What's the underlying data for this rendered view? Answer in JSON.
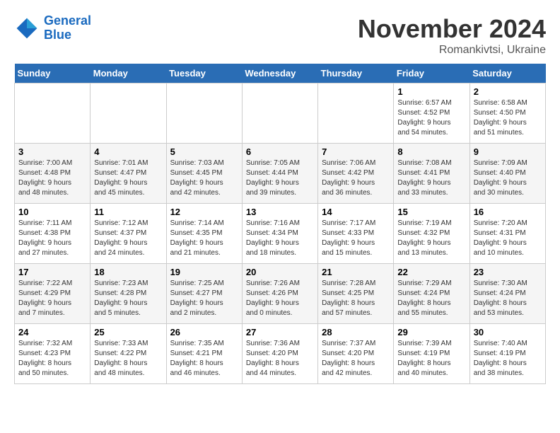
{
  "header": {
    "logo_line1": "General",
    "logo_line2": "Blue",
    "month_year": "November 2024",
    "location": "Romankivtsi, Ukraine"
  },
  "weekdays": [
    "Sunday",
    "Monday",
    "Tuesday",
    "Wednesday",
    "Thursday",
    "Friday",
    "Saturday"
  ],
  "weeks": [
    [
      {
        "day": "",
        "info": ""
      },
      {
        "day": "",
        "info": ""
      },
      {
        "day": "",
        "info": ""
      },
      {
        "day": "",
        "info": ""
      },
      {
        "day": "",
        "info": ""
      },
      {
        "day": "1",
        "info": "Sunrise: 6:57 AM\nSunset: 4:52 PM\nDaylight: 9 hours\nand 54 minutes."
      },
      {
        "day": "2",
        "info": "Sunrise: 6:58 AM\nSunset: 4:50 PM\nDaylight: 9 hours\nand 51 minutes."
      }
    ],
    [
      {
        "day": "3",
        "info": "Sunrise: 7:00 AM\nSunset: 4:48 PM\nDaylight: 9 hours\nand 48 minutes."
      },
      {
        "day": "4",
        "info": "Sunrise: 7:01 AM\nSunset: 4:47 PM\nDaylight: 9 hours\nand 45 minutes."
      },
      {
        "day": "5",
        "info": "Sunrise: 7:03 AM\nSunset: 4:45 PM\nDaylight: 9 hours\nand 42 minutes."
      },
      {
        "day": "6",
        "info": "Sunrise: 7:05 AM\nSunset: 4:44 PM\nDaylight: 9 hours\nand 39 minutes."
      },
      {
        "day": "7",
        "info": "Sunrise: 7:06 AM\nSunset: 4:42 PM\nDaylight: 9 hours\nand 36 minutes."
      },
      {
        "day": "8",
        "info": "Sunrise: 7:08 AM\nSunset: 4:41 PM\nDaylight: 9 hours\nand 33 minutes."
      },
      {
        "day": "9",
        "info": "Sunrise: 7:09 AM\nSunset: 4:40 PM\nDaylight: 9 hours\nand 30 minutes."
      }
    ],
    [
      {
        "day": "10",
        "info": "Sunrise: 7:11 AM\nSunset: 4:38 PM\nDaylight: 9 hours\nand 27 minutes."
      },
      {
        "day": "11",
        "info": "Sunrise: 7:12 AM\nSunset: 4:37 PM\nDaylight: 9 hours\nand 24 minutes."
      },
      {
        "day": "12",
        "info": "Sunrise: 7:14 AM\nSunset: 4:35 PM\nDaylight: 9 hours\nand 21 minutes."
      },
      {
        "day": "13",
        "info": "Sunrise: 7:16 AM\nSunset: 4:34 PM\nDaylight: 9 hours\nand 18 minutes."
      },
      {
        "day": "14",
        "info": "Sunrise: 7:17 AM\nSunset: 4:33 PM\nDaylight: 9 hours\nand 15 minutes."
      },
      {
        "day": "15",
        "info": "Sunrise: 7:19 AM\nSunset: 4:32 PM\nDaylight: 9 hours\nand 13 minutes."
      },
      {
        "day": "16",
        "info": "Sunrise: 7:20 AM\nSunset: 4:31 PM\nDaylight: 9 hours\nand 10 minutes."
      }
    ],
    [
      {
        "day": "17",
        "info": "Sunrise: 7:22 AM\nSunset: 4:29 PM\nDaylight: 9 hours\nand 7 minutes."
      },
      {
        "day": "18",
        "info": "Sunrise: 7:23 AM\nSunset: 4:28 PM\nDaylight: 9 hours\nand 5 minutes."
      },
      {
        "day": "19",
        "info": "Sunrise: 7:25 AM\nSunset: 4:27 PM\nDaylight: 9 hours\nand 2 minutes."
      },
      {
        "day": "20",
        "info": "Sunrise: 7:26 AM\nSunset: 4:26 PM\nDaylight: 9 hours\nand 0 minutes."
      },
      {
        "day": "21",
        "info": "Sunrise: 7:28 AM\nSunset: 4:25 PM\nDaylight: 8 hours\nand 57 minutes."
      },
      {
        "day": "22",
        "info": "Sunrise: 7:29 AM\nSunset: 4:24 PM\nDaylight: 8 hours\nand 55 minutes."
      },
      {
        "day": "23",
        "info": "Sunrise: 7:30 AM\nSunset: 4:24 PM\nDaylight: 8 hours\nand 53 minutes."
      }
    ],
    [
      {
        "day": "24",
        "info": "Sunrise: 7:32 AM\nSunset: 4:23 PM\nDaylight: 8 hours\nand 50 minutes."
      },
      {
        "day": "25",
        "info": "Sunrise: 7:33 AM\nSunset: 4:22 PM\nDaylight: 8 hours\nand 48 minutes."
      },
      {
        "day": "26",
        "info": "Sunrise: 7:35 AM\nSunset: 4:21 PM\nDaylight: 8 hours\nand 46 minutes."
      },
      {
        "day": "27",
        "info": "Sunrise: 7:36 AM\nSunset: 4:20 PM\nDaylight: 8 hours\nand 44 minutes."
      },
      {
        "day": "28",
        "info": "Sunrise: 7:37 AM\nSunset: 4:20 PM\nDaylight: 8 hours\nand 42 minutes."
      },
      {
        "day": "29",
        "info": "Sunrise: 7:39 AM\nSunset: 4:19 PM\nDaylight: 8 hours\nand 40 minutes."
      },
      {
        "day": "30",
        "info": "Sunrise: 7:40 AM\nSunset: 4:19 PM\nDaylight: 8 hours\nand 38 minutes."
      }
    ]
  ]
}
